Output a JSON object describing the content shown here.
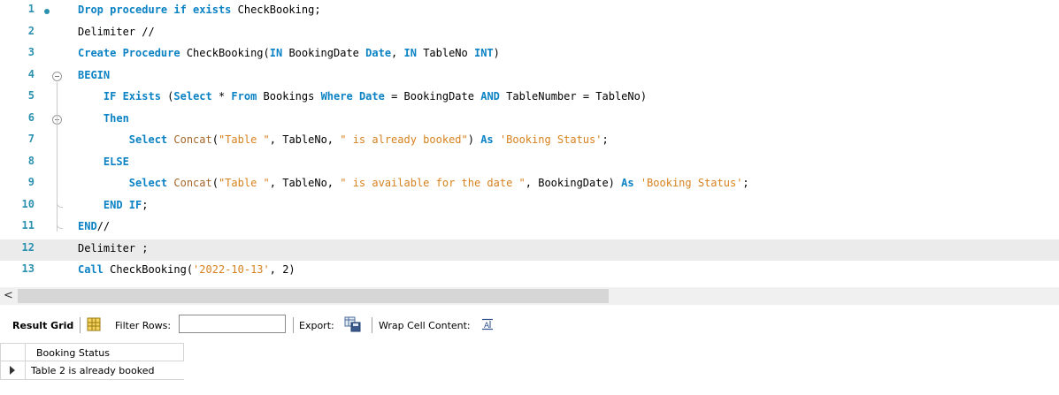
{
  "editor": {
    "lines": [
      {
        "num": "1",
        "tokens": [
          {
            "t": "Drop procedure if exists ",
            "c": "kw"
          },
          {
            "t": "CheckBooking;",
            "c": ""
          }
        ]
      },
      {
        "num": "2",
        "tokens": [
          {
            "t": "Delimiter //",
            "c": ""
          }
        ]
      },
      {
        "num": "3",
        "tokens": [
          {
            "t": "Create Procedure ",
            "c": "kw"
          },
          {
            "t": "CheckBooking(",
            "c": ""
          },
          {
            "t": "IN ",
            "c": "kw"
          },
          {
            "t": "BookingDate ",
            "c": ""
          },
          {
            "t": "Date",
            "c": "kw"
          },
          {
            "t": ", ",
            "c": ""
          },
          {
            "t": "IN ",
            "c": "kw"
          },
          {
            "t": "TableNo ",
            "c": ""
          },
          {
            "t": "INT",
            "c": "kw"
          },
          {
            "t": ")",
            "c": ""
          }
        ]
      },
      {
        "num": "4",
        "tokens": [
          {
            "t": "BEGIN",
            "c": "kw"
          }
        ]
      },
      {
        "num": "5",
        "tokens": [
          {
            "t": "    ",
            "c": ""
          },
          {
            "t": "IF Exists ",
            "c": "kw"
          },
          {
            "t": "(",
            "c": ""
          },
          {
            "t": "Select ",
            "c": "kw"
          },
          {
            "t": "* ",
            "c": ""
          },
          {
            "t": "From ",
            "c": "kw"
          },
          {
            "t": "Bookings ",
            "c": ""
          },
          {
            "t": "Where ",
            "c": "kw"
          },
          {
            "t": "Date ",
            "c": "kw"
          },
          {
            "t": "= BookingDate ",
            "c": ""
          },
          {
            "t": "AND ",
            "c": "kw"
          },
          {
            "t": "TableNumber = TableNo)",
            "c": ""
          }
        ]
      },
      {
        "num": "6",
        "tokens": [
          {
            "t": "    ",
            "c": ""
          },
          {
            "t": "Then",
            "c": "kw"
          }
        ]
      },
      {
        "num": "7",
        "tokens": [
          {
            "t": "        ",
            "c": ""
          },
          {
            "t": "Select ",
            "c": "kw"
          },
          {
            "t": "Concat",
            "c": "fn"
          },
          {
            "t": "(",
            "c": ""
          },
          {
            "t": "\"Table \"",
            "c": "str"
          },
          {
            "t": ", TableNo, ",
            "c": ""
          },
          {
            "t": "\" is already booked\"",
            "c": "str"
          },
          {
            "t": ") ",
            "c": ""
          },
          {
            "t": "As ",
            "c": "kw"
          },
          {
            "t": "'Booking Status'",
            "c": "str"
          },
          {
            "t": ";",
            "c": ""
          }
        ]
      },
      {
        "num": "8",
        "tokens": [
          {
            "t": "    ",
            "c": ""
          },
          {
            "t": "ELSE",
            "c": "kw"
          }
        ]
      },
      {
        "num": "9",
        "tokens": [
          {
            "t": "        ",
            "c": ""
          },
          {
            "t": "Select ",
            "c": "kw"
          },
          {
            "t": "Concat",
            "c": "fn"
          },
          {
            "t": "(",
            "c": ""
          },
          {
            "t": "\"Table \"",
            "c": "str"
          },
          {
            "t": ", TableNo, ",
            "c": ""
          },
          {
            "t": "\" is available for the date \"",
            "c": "str"
          },
          {
            "t": ", BookingDate) ",
            "c": ""
          },
          {
            "t": "As ",
            "c": "kw"
          },
          {
            "t": "'Booking Status'",
            "c": "str"
          },
          {
            "t": ";",
            "c": ""
          }
        ]
      },
      {
        "num": "10",
        "tokens": [
          {
            "t": "    ",
            "c": ""
          },
          {
            "t": "END IF",
            "c": "kw"
          },
          {
            "t": ";",
            "c": ""
          }
        ]
      },
      {
        "num": "11",
        "tokens": [
          {
            "t": "END",
            "c": "kw"
          },
          {
            "t": "//",
            "c": ""
          }
        ]
      },
      {
        "num": "12",
        "tokens": [
          {
            "t": "Delimiter ;",
            "c": ""
          }
        ]
      },
      {
        "num": "13",
        "tokens": [
          {
            "t": "Call ",
            "c": "kw"
          },
          {
            "t": "CheckBooking(",
            "c": ""
          },
          {
            "t": "'2022-10-13'",
            "c": "str"
          },
          {
            "t": ", 2)",
            "c": ""
          }
        ]
      }
    ]
  },
  "scrollbar": {
    "left_arrow": "<"
  },
  "toolbar": {
    "result_grid_label": "Result Grid",
    "filter_rows_label": "Filter Rows:",
    "filter_value": "",
    "export_label": "Export:",
    "wrap_label": "Wrap Cell Content:"
  },
  "grid": {
    "columns": [
      "Booking Status"
    ],
    "rows": [
      [
        "Table 2 is already booked"
      ]
    ]
  },
  "colors": {
    "keyword": "#0b82c4",
    "function": "#a5672a",
    "string": "#d7821e",
    "line_number": "#2b91af",
    "current_line": "#ebebeb"
  }
}
